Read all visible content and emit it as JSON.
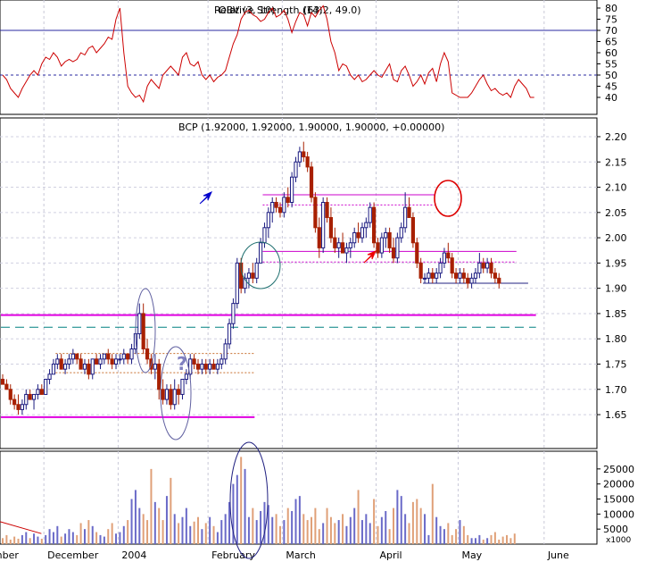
{
  "chart_data": [
    {
      "type": "line",
      "panel": "rsi",
      "title": "Relative Strength (14)",
      "overlay_title": "OBV (3, 10)",
      "title_readout": "(63.2, 49.0)",
      "ylim": [
        34,
        82
      ],
      "yticks": [
        40,
        45,
        50,
        55,
        60,
        65,
        70,
        75,
        80
      ],
      "reference_lines": [
        {
          "value": 70,
          "style": "solid",
          "color": "#2a2aa0"
        },
        {
          "value": 50,
          "style": "dashed",
          "color": "#2a2aa0"
        }
      ],
      "series": [
        {
          "color": "#cc0000",
          "values": [
            50,
            48,
            44,
            42,
            40,
            44,
            47,
            50,
            52,
            50,
            55,
            58,
            57,
            60,
            58,
            54,
            56,
            57,
            56,
            57,
            60,
            59,
            62,
            63,
            60,
            62,
            64,
            67,
            66,
            75,
            80,
            60,
            45,
            42,
            40,
            41,
            38,
            45,
            48,
            46,
            44,
            50,
            52,
            54,
            52,
            50,
            58,
            60,
            55,
            54,
            56,
            50,
            48,
            50,
            47,
            49,
            50,
            52,
            58,
            64,
            68,
            75,
            78,
            79,
            77,
            76,
            74,
            75,
            78,
            80,
            76,
            77,
            79,
            75,
            69,
            74,
            78,
            77,
            72,
            78,
            76,
            79,
            81,
            75,
            65,
            60,
            52,
            55,
            54,
            50,
            48,
            50,
            47,
            48,
            50,
            52,
            50,
            49,
            52,
            55,
            48,
            47,
            52,
            54,
            50,
            45,
            47,
            50,
            46,
            51,
            53,
            47,
            55,
            60,
            56,
            42,
            41,
            40,
            40,
            40,
            42,
            45,
            48,
            50,
            46,
            43,
            44,
            42,
            41,
            42,
            40,
            45,
            48,
            46,
            44,
            40,
            40
          ]
        }
      ]
    },
    {
      "type": "candlestick",
      "panel": "price",
      "title": "BCP (1.92000, 1.92000, 1.90000, 1.90000, +0.00000)",
      "ylim": [
        1.59,
        2.23
      ],
      "yticks": [
        1.65,
        1.7,
        1.75,
        1.8,
        1.85,
        1.9,
        1.95,
        2.0,
        2.05,
        2.1,
        2.15,
        2.2
      ],
      "up_color": "#1a1a80",
      "down_color": "#a82000",
      "reference_lines": [
        {
          "value": 1.847,
          "style": "solid",
          "color": "#e000e0",
          "from": 0,
          "to": 136
        },
        {
          "value": 1.645,
          "style": "solid",
          "color": "#e000e0",
          "from": 0,
          "to": 64
        },
        {
          "value": 1.823,
          "style": "dash",
          "color": "#008080",
          "from": 0,
          "to": 136
        },
        {
          "value": 1.771,
          "style": "dotted",
          "color": "#c87030",
          "from": 14,
          "to": 64
        },
        {
          "value": 1.733,
          "style": "dotted",
          "color": "#c87030",
          "from": 14,
          "to": 64
        },
        {
          "value": 2.085,
          "style": "solid",
          "color": "#cc00cc",
          "from": 67,
          "to": 110
        },
        {
          "value": 2.065,
          "style": "dotted",
          "color": "#cc00cc",
          "from": 67,
          "to": 110
        },
        {
          "value": 1.973,
          "style": "solid",
          "color": "#cc00cc",
          "from": 67,
          "to": 131
        },
        {
          "value": 1.952,
          "style": "dotted",
          "color": "#cc00cc",
          "from": 67,
          "to": 131
        },
        {
          "value": 1.91,
          "style": "solid",
          "color": "#202080",
          "from": 108,
          "to": 134
        }
      ],
      "candles": [
        [
          1.72,
          1.73,
          1.71,
          1.71
        ],
        [
          1.71,
          1.72,
          1.7,
          1.7
        ],
        [
          1.7,
          1.71,
          1.67,
          1.68
        ],
        [
          1.68,
          1.69,
          1.66,
          1.67
        ],
        [
          1.67,
          1.69,
          1.65,
          1.66
        ],
        [
          1.66,
          1.68,
          1.65,
          1.67
        ],
        [
          1.67,
          1.7,
          1.66,
          1.69
        ],
        [
          1.69,
          1.7,
          1.68,
          1.68
        ],
        [
          1.68,
          1.69,
          1.66,
          1.69
        ],
        [
          1.69,
          1.71,
          1.68,
          1.7
        ],
        [
          1.7,
          1.71,
          1.69,
          1.69
        ],
        [
          1.69,
          1.72,
          1.69,
          1.72
        ],
        [
          1.72,
          1.74,
          1.71,
          1.73
        ],
        [
          1.73,
          1.76,
          1.73,
          1.75
        ],
        [
          1.75,
          1.77,
          1.74,
          1.76
        ],
        [
          1.76,
          1.77,
          1.74,
          1.74
        ],
        [
          1.74,
          1.76,
          1.73,
          1.75
        ],
        [
          1.75,
          1.77,
          1.74,
          1.76
        ],
        [
          1.76,
          1.78,
          1.75,
          1.77
        ],
        [
          1.77,
          1.77,
          1.75,
          1.76
        ],
        [
          1.76,
          1.77,
          1.74,
          1.74
        ],
        [
          1.74,
          1.76,
          1.73,
          1.75
        ],
        [
          1.75,
          1.76,
          1.72,
          1.73
        ],
        [
          1.73,
          1.76,
          1.72,
          1.76
        ],
        [
          1.76,
          1.77,
          1.75,
          1.75
        ],
        [
          1.75,
          1.77,
          1.74,
          1.76
        ],
        [
          1.76,
          1.77,
          1.75,
          1.77
        ],
        [
          1.77,
          1.78,
          1.75,
          1.76
        ],
        [
          1.76,
          1.77,
          1.74,
          1.75
        ],
        [
          1.75,
          1.77,
          1.74,
          1.76
        ],
        [
          1.76,
          1.77,
          1.75,
          1.76
        ],
        [
          1.76,
          1.78,
          1.75,
          1.77
        ],
        [
          1.77,
          1.77,
          1.75,
          1.76
        ],
        [
          1.76,
          1.79,
          1.75,
          1.78
        ],
        [
          1.78,
          1.82,
          1.77,
          1.81
        ],
        [
          1.81,
          1.87,
          1.8,
          1.85
        ],
        [
          1.85,
          1.87,
          1.77,
          1.78
        ],
        [
          1.78,
          1.8,
          1.75,
          1.76
        ],
        [
          1.76,
          1.77,
          1.73,
          1.74
        ],
        [
          1.74,
          1.77,
          1.72,
          1.75
        ],
        [
          1.75,
          1.76,
          1.68,
          1.7
        ],
        [
          1.7,
          1.72,
          1.67,
          1.68
        ],
        [
          1.68,
          1.71,
          1.67,
          1.7
        ],
        [
          1.7,
          1.71,
          1.66,
          1.67
        ],
        [
          1.67,
          1.72,
          1.66,
          1.7
        ],
        [
          1.7,
          1.71,
          1.67,
          1.69
        ],
        [
          1.69,
          1.72,
          1.68,
          1.72
        ],
        [
          1.72,
          1.74,
          1.71,
          1.73
        ],
        [
          1.73,
          1.77,
          1.72,
          1.76
        ],
        [
          1.76,
          1.77,
          1.74,
          1.75
        ],
        [
          1.75,
          1.76,
          1.73,
          1.74
        ],
        [
          1.74,
          1.76,
          1.73,
          1.75
        ],
        [
          1.75,
          1.76,
          1.73,
          1.74
        ],
        [
          1.74,
          1.76,
          1.73,
          1.75
        ],
        [
          1.75,
          1.76,
          1.74,
          1.74
        ],
        [
          1.74,
          1.76,
          1.73,
          1.75
        ],
        [
          1.75,
          1.77,
          1.74,
          1.76
        ],
        [
          1.76,
          1.8,
          1.75,
          1.79
        ],
        [
          1.79,
          1.84,
          1.78,
          1.83
        ],
        [
          1.83,
          1.88,
          1.82,
          1.87
        ],
        [
          1.87,
          1.96,
          1.86,
          1.95
        ],
        [
          1.95,
          1.96,
          1.89,
          1.9
        ],
        [
          1.9,
          1.93,
          1.89,
          1.92
        ],
        [
          1.92,
          1.94,
          1.9,
          1.93
        ],
        [
          1.93,
          1.95,
          1.91,
          1.92
        ],
        [
          1.92,
          1.96,
          1.91,
          1.95
        ],
        [
          1.95,
          2.0,
          1.95,
          1.99
        ],
        [
          1.99,
          2.03,
          1.98,
          2.02
        ],
        [
          2.02,
          2.06,
          2.0,
          2.05
        ],
        [
          2.05,
          2.08,
          2.03,
          2.07
        ],
        [
          2.07,
          2.08,
          2.05,
          2.06
        ],
        [
          2.06,
          2.07,
          2.04,
          2.05
        ],
        [
          2.05,
          2.09,
          2.04,
          2.08
        ],
        [
          2.08,
          2.1,
          2.06,
          2.07
        ],
        [
          2.07,
          2.13,
          2.06,
          2.12
        ],
        [
          2.12,
          2.16,
          2.11,
          2.15
        ],
        [
          2.15,
          2.18,
          2.14,
          2.17
        ],
        [
          2.17,
          2.19,
          2.15,
          2.16
        ],
        [
          2.16,
          2.17,
          2.13,
          2.14
        ],
        [
          2.14,
          2.15,
          2.07,
          2.08
        ],
        [
          2.08,
          2.09,
          2.01,
          2.02
        ],
        [
          2.02,
          2.04,
          1.96,
          1.98
        ],
        [
          1.98,
          2.08,
          1.97,
          2.07
        ],
        [
          2.07,
          2.08,
          2.03,
          2.04
        ],
        [
          2.04,
          2.06,
          1.99,
          2.0
        ],
        [
          2.0,
          2.02,
          1.97,
          1.98
        ],
        [
          1.98,
          2.0,
          1.96,
          1.99
        ],
        [
          1.99,
          2.01,
          1.97,
          1.97
        ],
        [
          1.97,
          1.99,
          1.95,
          1.98
        ],
        [
          1.98,
          2.0,
          1.96,
          1.99
        ],
        [
          1.99,
          2.02,
          1.98,
          2.01
        ],
        [
          2.01,
          2.03,
          1.99,
          2.0
        ],
        [
          2.0,
          2.03,
          1.99,
          2.02
        ],
        [
          2.02,
          2.04,
          2.0,
          2.03
        ],
        [
          2.03,
          2.07,
          2.02,
          2.06
        ],
        [
          2.06,
          2.07,
          1.98,
          1.99
        ],
        [
          1.99,
          2.0,
          1.96,
          1.97
        ],
        [
          1.97,
          2.01,
          1.96,
          2.0
        ],
        [
          2.0,
          2.02,
          1.98,
          2.01
        ],
        [
          2.01,
          2.02,
          1.97,
          1.98
        ],
        [
          1.98,
          2.0,
          1.95,
          1.96
        ],
        [
          1.96,
          2.01,
          1.95,
          2.0
        ],
        [
          2.0,
          2.03,
          1.99,
          2.02
        ],
        [
          2.02,
          2.09,
          2.01,
          2.06
        ],
        [
          2.06,
          2.08,
          2.04,
          2.04
        ],
        [
          2.04,
          2.05,
          1.98,
          1.99
        ],
        [
          1.99,
          2.0,
          1.94,
          1.95
        ],
        [
          1.95,
          1.96,
          1.91,
          1.92
        ],
        [
          1.92,
          1.93,
          1.91,
          1.92
        ],
        [
          1.92,
          1.94,
          1.91,
          1.93
        ],
        [
          1.93,
          1.94,
          1.91,
          1.92
        ],
        [
          1.92,
          1.94,
          1.91,
          1.93
        ],
        [
          1.93,
          1.96,
          1.92,
          1.95
        ],
        [
          1.95,
          1.98,
          1.94,
          1.97
        ],
        [
          1.97,
          1.99,
          1.95,
          1.96
        ],
        [
          1.96,
          1.97,
          1.92,
          1.93
        ],
        [
          1.93,
          1.94,
          1.91,
          1.92
        ],
        [
          1.92,
          1.94,
          1.91,
          1.93
        ],
        [
          1.93,
          1.94,
          1.91,
          1.92
        ],
        [
          1.92,
          1.93,
          1.9,
          1.91
        ],
        [
          1.91,
          1.93,
          1.9,
          1.92
        ],
        [
          1.92,
          1.94,
          1.91,
          1.93
        ],
        [
          1.93,
          1.97,
          1.92,
          1.95
        ],
        [
          1.95,
          1.96,
          1.93,
          1.94
        ],
        [
          1.94,
          1.96,
          1.93,
          1.95
        ],
        [
          1.95,
          1.96,
          1.92,
          1.93
        ],
        [
          1.93,
          1.94,
          1.91,
          1.92
        ],
        [
          1.92,
          1.93,
          1.9,
          1.91
        ]
      ]
    },
    {
      "type": "bar",
      "panel": "volume",
      "ylim": [
        0,
        30000
      ],
      "yticks": [
        5000,
        10000,
        15000,
        20000,
        25000
      ],
      "unit_label": "x1000",
      "colors": {
        "up": "#6a6ac8",
        "down": "#e0a078"
      },
      "values": [
        2000,
        3000,
        1500,
        2500,
        1800,
        3000,
        4000,
        2000,
        3500,
        2500,
        1800,
        3000,
        5000,
        4000,
        6000,
        2500,
        3500,
        5000,
        4000,
        3000,
        7000,
        5000,
        8000,
        6000,
        4000,
        3000,
        2500,
        5000,
        7000,
        3500,
        4000,
        6000,
        8000,
        15000,
        18000,
        12000,
        10000,
        8000,
        25000,
        14000,
        12000,
        8000,
        16000,
        22000,
        10000,
        7000,
        9000,
        12000,
        6000,
        7500,
        9000,
        5000,
        7000,
        9000,
        6000,
        4000,
        8000,
        10000,
        14000,
        20000,
        23000,
        29000,
        25000,
        9000,
        12000,
        8000,
        11000,
        14000,
        13000,
        9000,
        10000,
        6000,
        8000,
        12000,
        11000,
        15000,
        16000,
        10000,
        8000,
        9000,
        12000,
        5000,
        7000,
        12000,
        9000,
        7000,
        8000,
        10000,
        6000,
        9000,
        12000,
        18000,
        8000,
        10000,
        7000,
        15000,
        6000,
        9000,
        11000,
        5000,
        12000,
        18000,
        16000,
        10000,
        7000,
        14000,
        15000,
        12000,
        10000,
        3000,
        20000,
        9000,
        6000,
        5000,
        7000,
        3000,
        5000,
        8000,
        6000,
        3000,
        2000,
        2000,
        3000,
        1500,
        2000,
        3000,
        4000,
        1500,
        2500,
        3000,
        2000,
        3500
      ]
    },
    {
      "type": "line",
      "panel": "volume-overlay",
      "series": [
        {
          "color": "#cc0000",
          "values": [
            7500,
            3500
          ]
        }
      ]
    },
    {
      "type": "axis",
      "panel": "time",
      "labels": [
        {
          "text": "mber",
          "at": -3
        },
        {
          "text": "December",
          "at": 11
        },
        {
          "text": "2004",
          "at": 30
        },
        {
          "text": "February",
          "at": 53
        },
        {
          "text": "March",
          "at": 72
        },
        {
          "text": "April",
          "at": 96
        },
        {
          "text": "May",
          "at": 117
        },
        {
          "text": "June",
          "at": 139
        }
      ],
      "divider_indices": [
        11,
        30,
        53,
        72,
        96,
        117,
        139
      ]
    }
  ],
  "annotations": {
    "question_mark": "?"
  }
}
